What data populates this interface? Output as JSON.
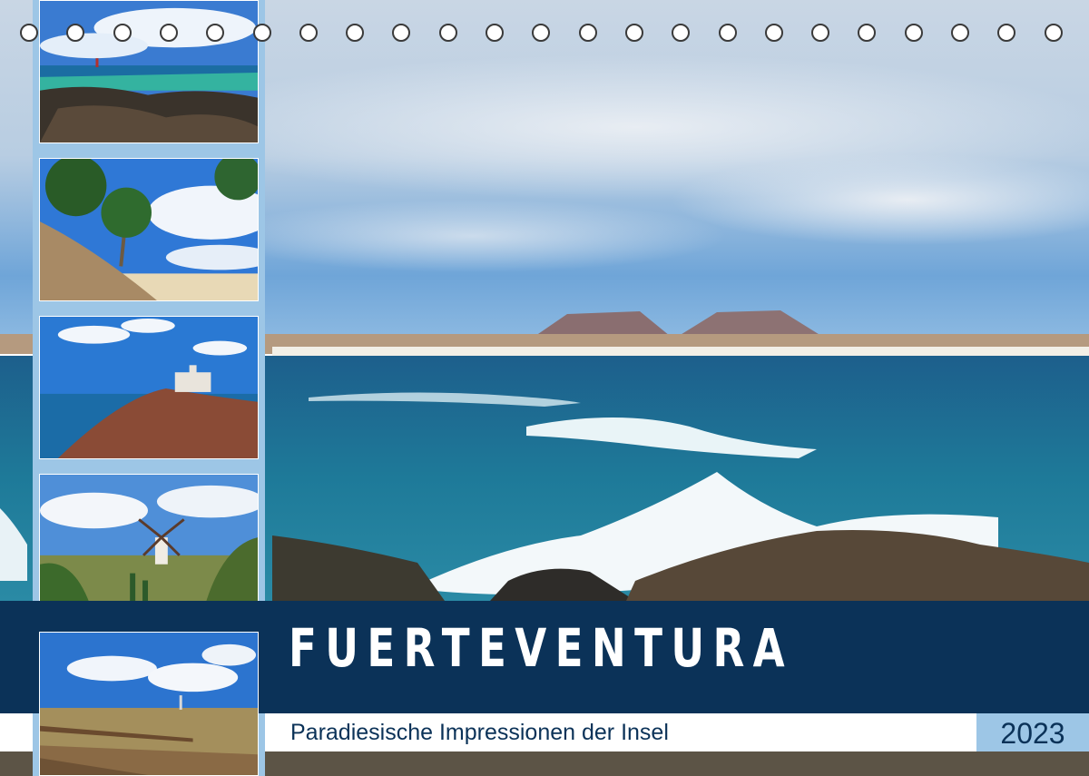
{
  "calendar": {
    "title": "FUERTEVENTURA",
    "subtitle": "Paradiesische Impressionen der Insel",
    "year": "2023"
  },
  "colors": {
    "title_band": "#0b3258",
    "accent_light_blue": "#9dc6e6",
    "text_white": "#ffffff"
  },
  "photos": {
    "main": "main-photo-ocean-waves-volcanoes",
    "thumbnails": [
      "thumb-lighthouse-lagoon",
      "thumb-palm-trees-beach",
      "thumb-castle-cliff-coast",
      "thumb-windmill-cactus",
      "thumb-boardwalk-dunes"
    ]
  }
}
